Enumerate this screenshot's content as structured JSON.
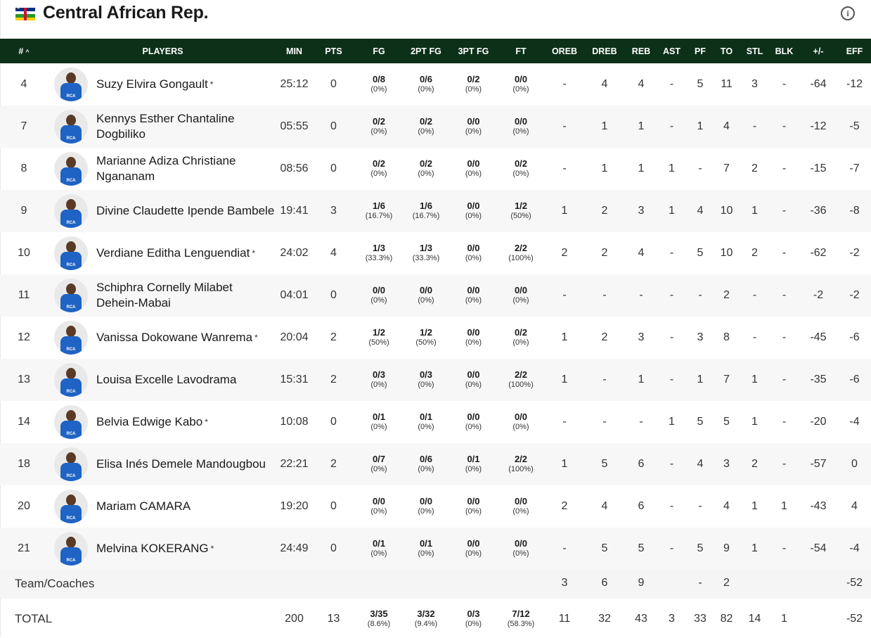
{
  "header": {
    "team_name": "Central African Rep.",
    "flag_icon": "flag-central-african-republic-icon",
    "flag_colors": [
      "#003082",
      "#ffffff",
      "#289728",
      "#ffce00",
      "#d21034"
    ],
    "info_icon": "info-icon",
    "info_glyph": "i"
  },
  "table": {
    "accent": "#0d3019",
    "columns": [
      "#",
      "PLAYERS",
      "MIN",
      "PTS",
      "FG",
      "2PT FG",
      "3PT FG",
      "FT",
      "OREB",
      "DREB",
      "REB",
      "AST",
      "PF",
      "TO",
      "STL",
      "BLK",
      "+/-",
      "EFF"
    ],
    "sort_indicator": "^",
    "starter_mark": "*",
    "players": [
      {
        "num": "4",
        "name": "Suzy Elvira Gongault",
        "starter": true,
        "min": "25:12",
        "pts": "0",
        "fg": "0/8",
        "fg_pct": "(0%)",
        "p2": "0/6",
        "p2_pct": "(0%)",
        "p3": "0/2",
        "p3_pct": "(0%)",
        "ft": "0/0",
        "ft_pct": "(0%)",
        "oreb": "-",
        "dreb": "4",
        "reb": "4",
        "ast": "-",
        "pf": "5",
        "to": "11",
        "stl": "3",
        "blk": "-",
        "pm": "-64",
        "eff": "-12"
      },
      {
        "num": "7",
        "name": "Kennys Esther Chantaline Dogbiliko",
        "starter": false,
        "min": "05:55",
        "pts": "0",
        "fg": "0/2",
        "fg_pct": "(0%)",
        "p2": "0/2",
        "p2_pct": "(0%)",
        "p3": "0/0",
        "p3_pct": "(0%)",
        "ft": "0/0",
        "ft_pct": "(0%)",
        "oreb": "-",
        "dreb": "1",
        "reb": "1",
        "ast": "-",
        "pf": "1",
        "to": "4",
        "stl": "-",
        "blk": "-",
        "pm": "-12",
        "eff": "-5"
      },
      {
        "num": "8",
        "name": "Marianne Adiza Christiane Ngananam",
        "starter": false,
        "min": "08:56",
        "pts": "0",
        "fg": "0/2",
        "fg_pct": "(0%)",
        "p2": "0/2",
        "p2_pct": "(0%)",
        "p3": "0/0",
        "p3_pct": "(0%)",
        "ft": "0/2",
        "ft_pct": "(0%)",
        "oreb": "-",
        "dreb": "1",
        "reb": "1",
        "ast": "1",
        "pf": "-",
        "to": "7",
        "stl": "2",
        "blk": "-",
        "pm": "-15",
        "eff": "-7"
      },
      {
        "num": "9",
        "name": "Divine Claudette Ipende Bambele",
        "starter": false,
        "min": "19:41",
        "pts": "3",
        "fg": "1/6",
        "fg_pct": "(16.7%)",
        "p2": "1/6",
        "p2_pct": "(16.7%)",
        "p3": "0/0",
        "p3_pct": "(0%)",
        "ft": "1/2",
        "ft_pct": "(50%)",
        "oreb": "1",
        "dreb": "2",
        "reb": "3",
        "ast": "1",
        "pf": "4",
        "to": "10",
        "stl": "1",
        "blk": "-",
        "pm": "-36",
        "eff": "-8"
      },
      {
        "num": "10",
        "name": "Verdiane Editha Lenguendiat",
        "starter": true,
        "min": "24:02",
        "pts": "4",
        "fg": "1/3",
        "fg_pct": "(33.3%)",
        "p2": "1/3",
        "p2_pct": "(33.3%)",
        "p3": "0/0",
        "p3_pct": "(0%)",
        "ft": "2/2",
        "ft_pct": "(100%)",
        "oreb": "2",
        "dreb": "2",
        "reb": "4",
        "ast": "-",
        "pf": "5",
        "to": "10",
        "stl": "2",
        "blk": "-",
        "pm": "-62",
        "eff": "-2"
      },
      {
        "num": "11",
        "name": "Schiphra Cornelly Milabet Dehein-Mabai",
        "starter": false,
        "min": "04:01",
        "pts": "0",
        "fg": "0/0",
        "fg_pct": "(0%)",
        "p2": "0/0",
        "p2_pct": "(0%)",
        "p3": "0/0",
        "p3_pct": "(0%)",
        "ft": "0/0",
        "ft_pct": "(0%)",
        "oreb": "-",
        "dreb": "-",
        "reb": "-",
        "ast": "-",
        "pf": "-",
        "to": "2",
        "stl": "-",
        "blk": "-",
        "pm": "-2",
        "eff": "-2"
      },
      {
        "num": "12",
        "name": "Vanissa Dokowane Wanrema",
        "starter": true,
        "min": "20:04",
        "pts": "2",
        "fg": "1/2",
        "fg_pct": "(50%)",
        "p2": "1/2",
        "p2_pct": "(50%)",
        "p3": "0/0",
        "p3_pct": "(0%)",
        "ft": "0/2",
        "ft_pct": "(0%)",
        "oreb": "1",
        "dreb": "2",
        "reb": "3",
        "ast": "-",
        "pf": "3",
        "to": "8",
        "stl": "-",
        "blk": "-",
        "pm": "-45",
        "eff": "-6"
      },
      {
        "num": "13",
        "name": "Louisa Excelle Lavodrama",
        "starter": false,
        "min": "15:31",
        "pts": "2",
        "fg": "0/3",
        "fg_pct": "(0%)",
        "p2": "0/3",
        "p2_pct": "(0%)",
        "p3": "0/0",
        "p3_pct": "(0%)",
        "ft": "2/2",
        "ft_pct": "(100%)",
        "oreb": "1",
        "dreb": "-",
        "reb": "1",
        "ast": "-",
        "pf": "1",
        "to": "7",
        "stl": "1",
        "blk": "-",
        "pm": "-35",
        "eff": "-6"
      },
      {
        "num": "14",
        "name": "Belvia Edwige Kabo",
        "starter": true,
        "min": "10:08",
        "pts": "0",
        "fg": "0/1",
        "fg_pct": "(0%)",
        "p2": "0/1",
        "p2_pct": "(0%)",
        "p3": "0/0",
        "p3_pct": "(0%)",
        "ft": "0/0",
        "ft_pct": "(0%)",
        "oreb": "-",
        "dreb": "-",
        "reb": "-",
        "ast": "1",
        "pf": "5",
        "to": "5",
        "stl": "1",
        "blk": "-",
        "pm": "-20",
        "eff": "-4"
      },
      {
        "num": "18",
        "name": "Elisa Inés Demele Mandougbou",
        "starter": false,
        "min": "22:21",
        "pts": "2",
        "fg": "0/7",
        "fg_pct": "(0%)",
        "p2": "0/6",
        "p2_pct": "(0%)",
        "p3": "0/1",
        "p3_pct": "(0%)",
        "ft": "2/2",
        "ft_pct": "(100%)",
        "oreb": "1",
        "dreb": "5",
        "reb": "6",
        "ast": "-",
        "pf": "4",
        "to": "3",
        "stl": "2",
        "blk": "-",
        "pm": "-57",
        "eff": "0"
      },
      {
        "num": "20",
        "name": "Mariam CAMARA",
        "starter": false,
        "min": "19:20",
        "pts": "0",
        "fg": "0/0",
        "fg_pct": "(0%)",
        "p2": "0/0",
        "p2_pct": "(0%)",
        "p3": "0/0",
        "p3_pct": "(0%)",
        "ft": "0/0",
        "ft_pct": "(0%)",
        "oreb": "2",
        "dreb": "4",
        "reb": "6",
        "ast": "-",
        "pf": "-",
        "to": "4",
        "stl": "1",
        "blk": "1",
        "pm": "-43",
        "eff": "4"
      },
      {
        "num": "21",
        "name": "Melvina KOKERANG",
        "starter": true,
        "min": "24:49",
        "pts": "0",
        "fg": "0/1",
        "fg_pct": "(0%)",
        "p2": "0/1",
        "p2_pct": "(0%)",
        "p3": "0/0",
        "p3_pct": "(0%)",
        "ft": "0/0",
        "ft_pct": "(0%)",
        "oreb": "-",
        "dreb": "5",
        "reb": "5",
        "ast": "-",
        "pf": "5",
        "to": "9",
        "stl": "1",
        "blk": "-",
        "pm": "-54",
        "eff": "-4"
      }
    ],
    "team_row": {
      "label": "Team/Coaches",
      "oreb": "3",
      "dreb": "6",
      "reb": "9",
      "pf": "-",
      "to": "2",
      "eff": "-52"
    },
    "total_row": {
      "label": "TOTAL",
      "min": "200",
      "pts": "13",
      "fg": "3/35",
      "fg_pct": "(8.6%)",
      "p2": "3/32",
      "p2_pct": "(9.4%)",
      "p3": "0/3",
      "p3_pct": "(0%)",
      "ft": "7/12",
      "ft_pct": "(58.3%)",
      "oreb": "11",
      "dreb": "32",
      "reb": "43",
      "ast": "3",
      "pf": "33",
      "to": "82",
      "stl": "14",
      "blk": "1",
      "eff": "-52"
    },
    "avatar_icon": "player-headshot-icon",
    "jersey_text": "RCA"
  }
}
